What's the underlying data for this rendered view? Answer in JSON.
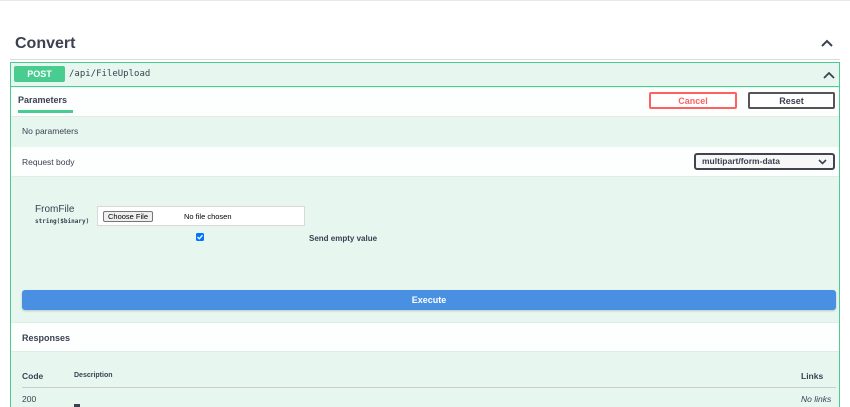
{
  "section": {
    "title": "Convert",
    "toggle_icon": "chevron-up-icon"
  },
  "operation": {
    "method": "POST",
    "path": "/api/FileUpload",
    "method_color": "#49cc90",
    "toggle_icon": "chevron-up-icon"
  },
  "parameters": {
    "tab_label": "Parameters",
    "cancel_label": "Cancel",
    "reset_label": "Reset",
    "empty_text": "No parameters"
  },
  "request_body": {
    "label": "Request body",
    "content_type": "multipart/form-data",
    "field": {
      "name": "FromFile",
      "type": "string($binary)",
      "choose_label": "Choose File",
      "file_status": "No file chosen",
      "send_empty_label": "Send empty value",
      "send_empty_checked": true
    }
  },
  "execute_label": "Execute",
  "responses": {
    "title": "Responses",
    "columns": {
      "code": "Code",
      "description": "Description",
      "links": "Links"
    },
    "rows": [
      {
        "code": "200",
        "links": "No links"
      }
    ]
  }
}
